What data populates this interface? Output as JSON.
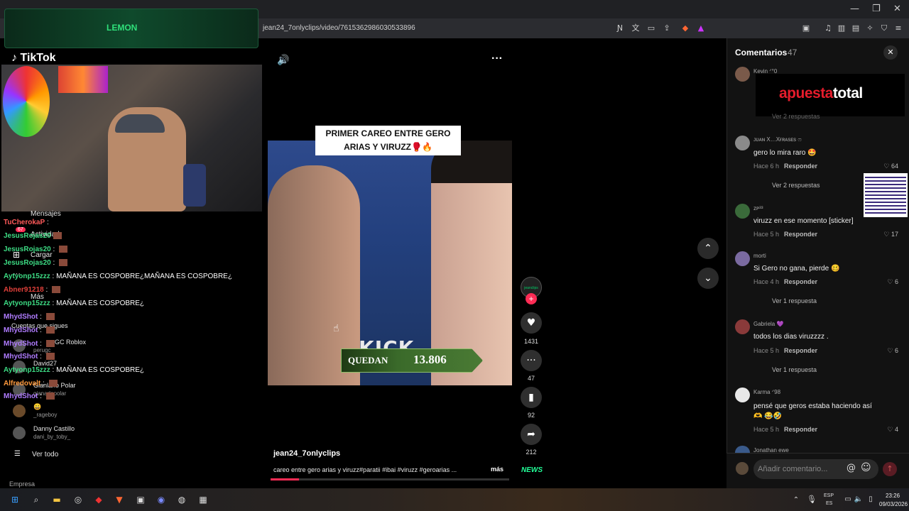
{
  "browser": {
    "url": "jean24_7onlyclips/video/7615362986030533896",
    "window_controls": [
      "—",
      "❐",
      "✕"
    ]
  },
  "overlay": {
    "banner": "LEMON",
    "tiktok_logo": "TikTok",
    "chat": [
      {
        "user": "TuCherokaP",
        "color": "#ff5a5a",
        "text": ""
      },
      {
        "user": "JesusRojas20",
        "color": "#3ddc84",
        "text": ""
      },
      {
        "user": "JesusRojas20",
        "color": "#3ddc84",
        "text": ""
      },
      {
        "user": "Aytyonp15zzz",
        "color": "#3ddc84",
        "text": "MAÑANA ES COSPOBRE¿MAÑANA ES COSPOBRE¿"
      },
      {
        "user": "Abner91218",
        "color": "#e0403a",
        "text": ""
      },
      {
        "user": "Aytyonp15zzz",
        "color": "#3ddc84",
        "text": "MAÑANA ES COSPOBRE¿"
      },
      {
        "user": "MhydShot",
        "color": "#b07cff",
        "text": ""
      },
      {
        "user": "MhydShot",
        "color": "#b07cff",
        "text": ""
      },
      {
        "user": "MhydShot",
        "color": "#b07cff",
        "text": ""
      },
      {
        "user": "MhydShot",
        "color": "#b07cff",
        "text": ""
      },
      {
        "user": "Aytyonp15zzz",
        "color": "#3ddc84",
        "text": "MAÑANA ES COSPOBRE¿"
      },
      {
        "user": "Alfredovalt",
        "color": "#ff9a3d",
        "text": ""
      },
      {
        "user": "MhydShot",
        "color": "#b07cff",
        "text": ""
      }
    ],
    "sidebar": {
      "mensajes": "Mensajes",
      "actividad": "Actividad",
      "actividad_badge": "67",
      "cargar": "Cargar",
      "mas": "Más",
      "cuentas_que_sigues": "Cuentas que sigues",
      "following": [
        {
          "name": "GC Roblox",
          "handle": "perugc"
        },
        {
          "name": "David27",
          "handle": ""
        },
        {
          "name": "Gianlarlo Polar",
          "handle": "gianarlopolar"
        },
        {
          "name": "😀",
          "handle": "_rageboy"
        },
        {
          "name": "Danny Castillo",
          "handle": "dani_by_toby_"
        }
      ],
      "ver_todo": "Ver todo",
      "empresa": "Empresa"
    }
  },
  "video": {
    "caption": "PRIMER CAREO ENTRE GERO ARIAS Y VIRUZZ🥊🔥",
    "kick_label": "KICK",
    "quedan_label": "QUEDAN",
    "quedan_value": "13.806",
    "author": "jean24_7onlyclips",
    "description": "careo entre gero arias y viruzz#paratii #ibai #viruzz #geroarias ...",
    "more": "más",
    "news_badge": "NEWS",
    "creator_badge": "jeanclips",
    "progress": 0.12,
    "actions": {
      "likes": "1431",
      "comments": "47",
      "saves": "92",
      "shares": "212"
    }
  },
  "comments": {
    "title": "Comentarios",
    "count": "47",
    "ad": {
      "part1": "apuesta",
      "part2": "total"
    },
    "items": [
      {
        "user": "Kevin ᐟ°0",
        "text": "",
        "time": "",
        "likes": "",
        "replies": "Ver 2 respuestas"
      },
      {
        "user": "ᴊᴜᴀɴ X…Xғʀᴀsᴇs ෆ",
        "text": "gero lo mira raro 🤩",
        "time": "Hace 6 h",
        "likes": "64",
        "replies": "Ver 2 respuestas"
      },
      {
        "user": "ᴢᴘ³³",
        "text": "viruzz en ese momento [sticker]",
        "time": "Hace 5 h",
        "likes": "17",
        "replies": ""
      },
      {
        "user": "morti",
        "text": "Si Gero no gana, pierde 🥴",
        "time": "Hace 4 h",
        "likes": "6",
        "replies": "Ver 1 respuesta"
      },
      {
        "user": "Gabriela 💜",
        "text": "todos los dias viruzzzz .",
        "time": "Hace 5 h",
        "likes": "6",
        "replies": "Ver 1 respuesta"
      },
      {
        "user": "Karma ᐟ98",
        "text": "pensé que geros estaba haciendo así 🫶 😂🤣",
        "time": "Hace 5 h",
        "likes": "4",
        "replies": ""
      },
      {
        "user": "Jonathan ewe",
        "text": "",
        "time": "",
        "likes": "",
        "replies": ""
      }
    ],
    "reply_label": "Responder",
    "input_placeholder": "Añadir comentario..."
  },
  "taskbar": {
    "lang1": "ESP",
    "lang2": "ES",
    "time": "23:26",
    "date": "09/03/2026"
  }
}
